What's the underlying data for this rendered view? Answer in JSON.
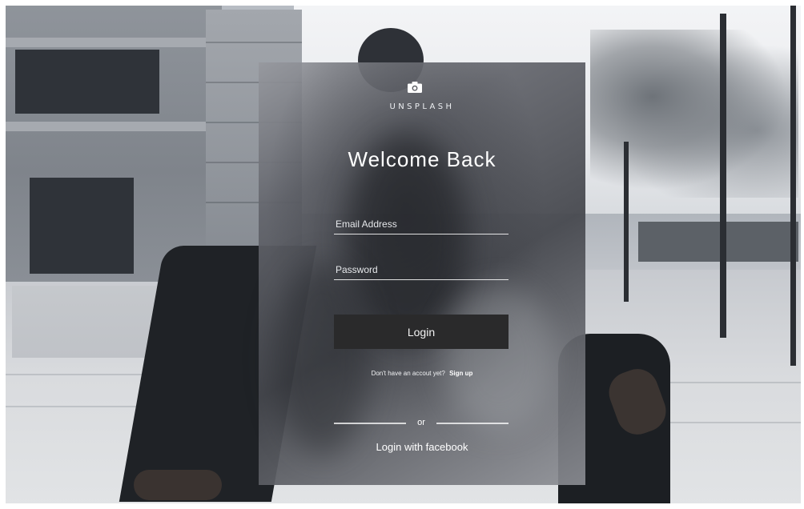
{
  "brand": {
    "name": "UNSPLASH",
    "icon": "camera-icon"
  },
  "login_card": {
    "title": "Welcome Back",
    "email_placeholder": "Email Address",
    "password_placeholder": "Password",
    "login_label": "Login",
    "signup_prompt": "Don't have an accout yet?",
    "signup_link": "Sign up",
    "divider_text": "or",
    "facebook_login": "Login with facebook"
  },
  "colors": {
    "card_tint": "#4a4c52",
    "button_bg": "#2a2a2b",
    "text": "#ffffff"
  }
}
